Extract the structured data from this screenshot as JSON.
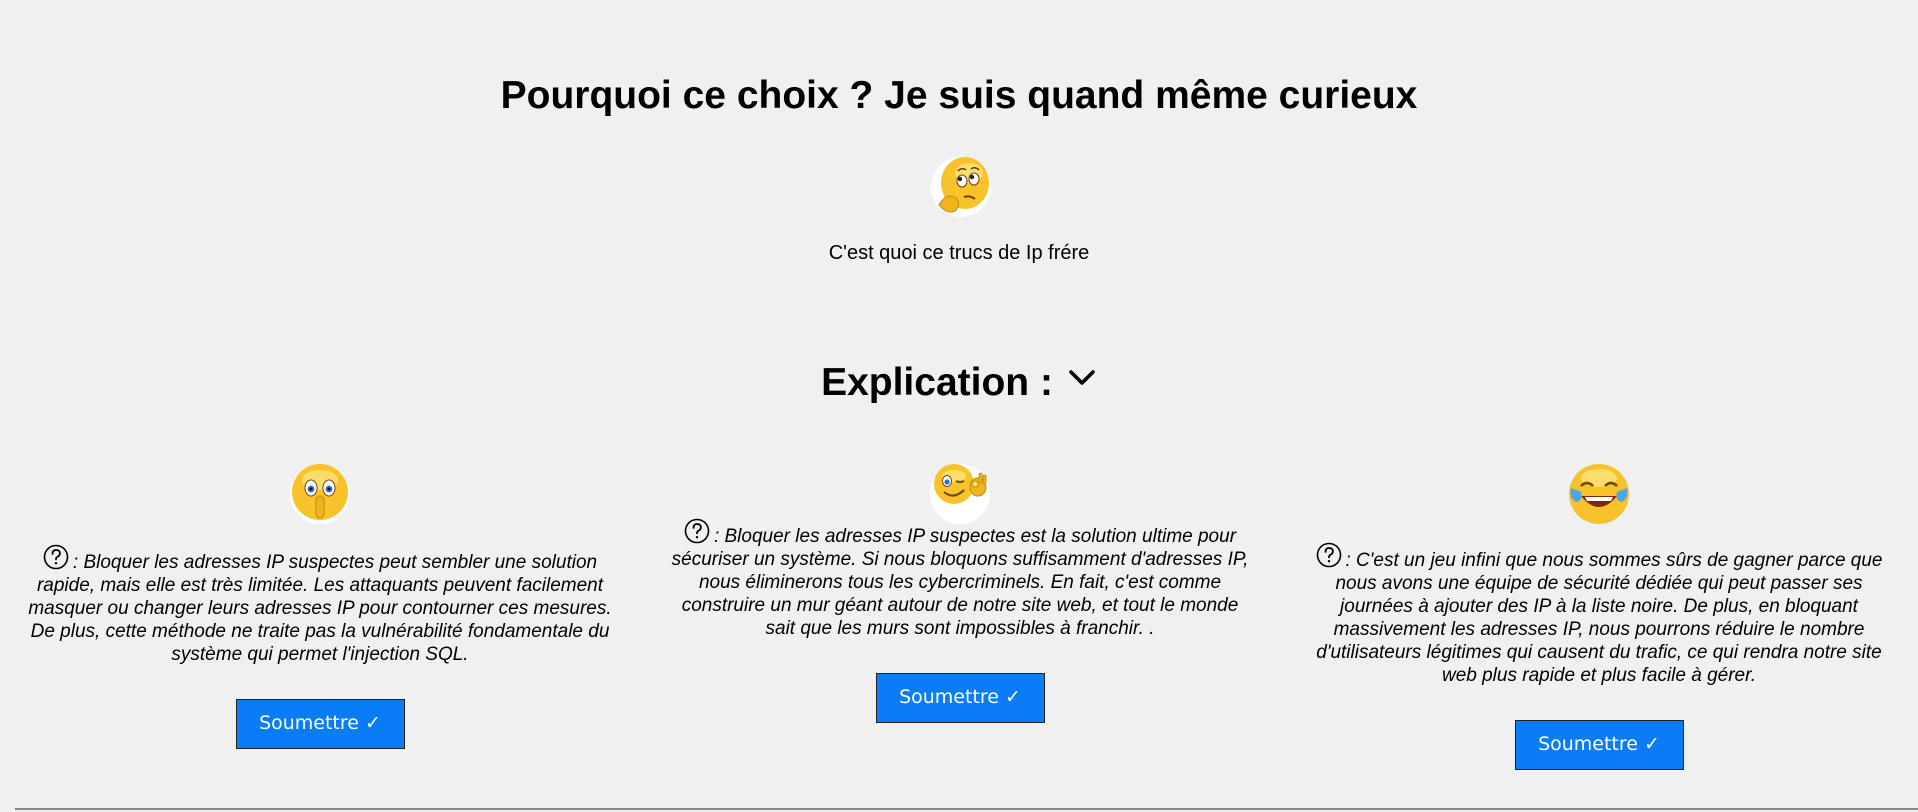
{
  "header": {
    "title": "Pourquoi ce choix ? Je suis quand même curieux",
    "subtitle": "C'est quoi ce trucs de Ip frére",
    "hero_icon": "thinking-face-emoji"
  },
  "explication": {
    "label": "Explication :",
    "icon": "chevron-down-icon"
  },
  "cards": [
    {
      "icon": "shushing-face-emoji",
      "text": ": Bloquer les adresses IP suspectes peut sembler une solution rapide, mais elle est très limitée. Les attaquants peuvent facilement masquer ou changer leurs adresses IP pour contourner ces mesures. De plus, cette méthode ne traite pas la vulnérabilité fondamentale du système qui permet l'injection SQL.",
      "button": "Soumettre ✓"
    },
    {
      "icon": "winking-face-ok-hand-emoji",
      "text": ": Bloquer les adresses IP suspectes est la solution ultime pour sécuriser un système. Si nous bloquons suffisamment d'adresses IP, nous éliminerons tous les cybercriminels. En fait, c'est comme construire un mur géant autour de notre site web, et tout le monde sait que les murs sont impossibles à franchir. .",
      "button": "Soumettre ✓"
    },
    {
      "icon": "tears-of-joy-emoji",
      "text": ": C'est un jeu infini que nous sommes sûrs de gagner parce que nous avons une équipe de sécurité dédiée qui peut passer ses journées à ajouter des IP à la liste noire. De plus, en bloquant massivement les adresses IP, nous pourrons réduire le nombre d'utilisateurs légitimes qui causent du trafic, ce qui rendra notre site web plus rapide et plus facile à gérer.",
      "button": "Soumettre ✓"
    }
  ],
  "colors": {
    "background": "#f0f0f0",
    "button": "#0a7cf6",
    "button_text": "#ffffff"
  }
}
